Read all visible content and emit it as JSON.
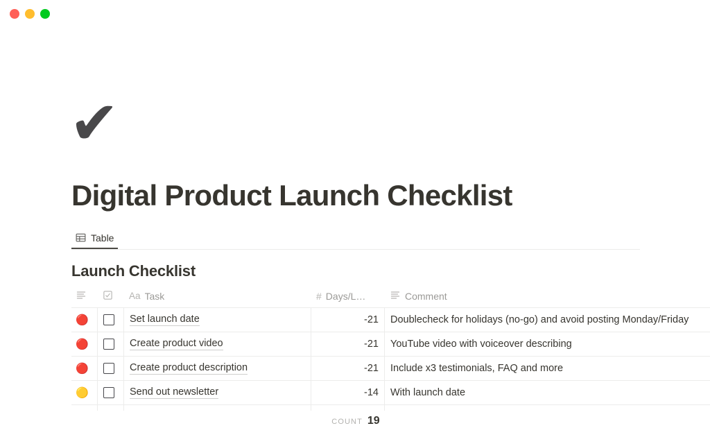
{
  "window": {
    "traffic_lights": [
      {
        "name": "close",
        "color": "#ff5f57"
      },
      {
        "name": "minimize",
        "color": "#ffbd2e"
      },
      {
        "name": "zoom",
        "color": "#00ca1f"
      }
    ]
  },
  "document": {
    "icon": "✔",
    "icon_name": "checkmark-emoji",
    "title": "Digital Product Launch Checklist"
  },
  "tabs": [
    {
      "label": "Table",
      "icon": "table-icon",
      "active": true
    }
  ],
  "database": {
    "title": "Launch Checklist",
    "columns": [
      {
        "key": "status",
        "label": "",
        "icon": "lines-icon"
      },
      {
        "key": "done",
        "label": "",
        "icon": "checkbox-icon"
      },
      {
        "key": "task",
        "label": "Task",
        "icon": "Aa"
      },
      {
        "key": "days",
        "label": "Days/L…",
        "icon": "#"
      },
      {
        "key": "comment",
        "label": "Comment",
        "icon": "lines-icon"
      }
    ],
    "rows": [
      {
        "status": "🔴",
        "status_color": "red",
        "done": false,
        "task": "Set launch date",
        "days": "-21",
        "comment": "Doublecheck for holidays (no-go) and avoid posting Monday/Friday"
      },
      {
        "status": "🔴",
        "status_color": "red",
        "done": false,
        "task": "Create product video",
        "days": "-21",
        "comment": "YouTube video with voiceover describing"
      },
      {
        "status": "🔴",
        "status_color": "red",
        "done": false,
        "task": "Create product description",
        "days": "-21",
        "comment": "Include x3 testimonials, FAQ and more"
      },
      {
        "status": "🟡",
        "status_color": "yellow",
        "done": false,
        "task": "Send out newsletter",
        "days": "-14",
        "comment": "With launch date"
      }
    ],
    "footer": {
      "count_label": "Count",
      "count_value": "19"
    }
  },
  "colors": {
    "text": "#37352f",
    "muted": "#9b9a97",
    "border": "#ececeb",
    "status_red": "#e03b2f",
    "status_yellow": "#f5c518"
  }
}
